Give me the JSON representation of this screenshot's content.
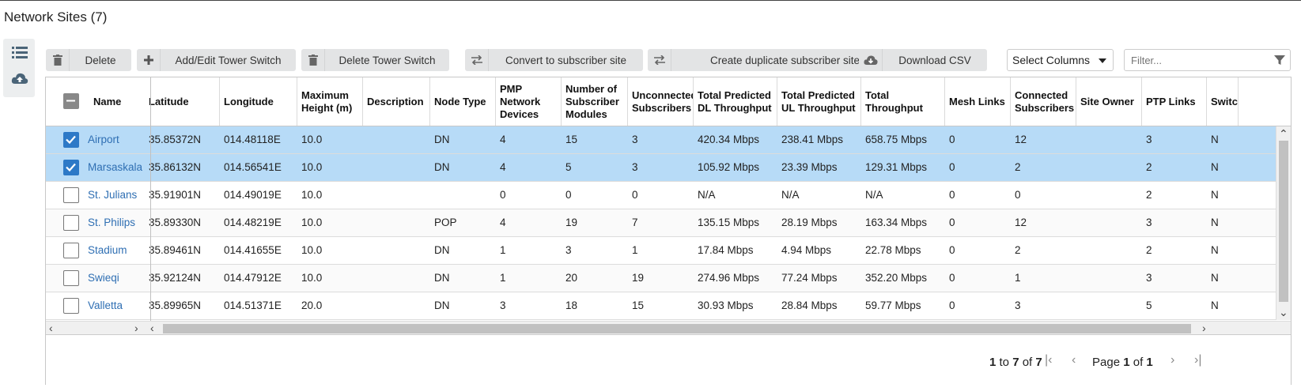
{
  "page": {
    "title": "Network Sites (7)"
  },
  "side_tools": [
    {
      "name": "list-view-icon"
    },
    {
      "name": "cloud-upload-icon"
    }
  ],
  "toolbar": {
    "buttons": [
      {
        "id": "delete",
        "label": "Delete",
        "icon": "trash-icon"
      },
      {
        "id": "add-edit-tower-switch",
        "label": "Add/Edit Tower Switch",
        "icon": "plus-icon"
      },
      {
        "id": "delete-tower-switch",
        "label": "Delete Tower Switch",
        "icon": "trash-icon"
      },
      {
        "id": "convert-to-subscriber",
        "label": "Convert to subscriber site",
        "icon": "swap-icon"
      },
      {
        "id": "create-duplicate-subscriber",
        "label": "Create duplicate subscriber site",
        "icon": "swap-icon"
      },
      {
        "id": "download-csv",
        "label": "Download CSV",
        "icon": "cloud-download-icon"
      }
    ],
    "select_columns": "Select Columns",
    "filter_placeholder": "Filter..."
  },
  "grid": {
    "columns": [
      "Name",
      "Latitude",
      "Longitude",
      "Maximum Height (m)",
      "Description",
      "Node Type",
      "PMP Network Devices",
      "Number of Subscriber Modules",
      "Unconnected Subscribers",
      "Total Predicted DL Throughput",
      "Total Predicted UL Throughput",
      "Total Throughput",
      "Mesh Links",
      "Connected Subscribers",
      "Site Owner",
      "PTP Links",
      "Switch"
    ],
    "rows": [
      {
        "selected": true,
        "cells": [
          "Airport",
          "35.85372N",
          "014.48118E",
          "10.0",
          "",
          "DN",
          "4",
          "15",
          "3",
          "420.34 Mbps",
          "238.41 Mbps",
          "658.75 Mbps",
          "0",
          "12",
          "",
          "3",
          "N"
        ]
      },
      {
        "selected": true,
        "cells": [
          "Marsaskala",
          "35.86132N",
          "014.56541E",
          "10.0",
          "",
          "DN",
          "4",
          "5",
          "3",
          "105.92 Mbps",
          "23.39 Mbps",
          "129.31 Mbps",
          "0",
          "2",
          "",
          "2",
          "N"
        ]
      },
      {
        "selected": false,
        "cells": [
          "St. Julians",
          "35.91901N",
          "014.49019E",
          "10.0",
          "",
          "",
          "0",
          "0",
          "0",
          "N/A",
          "N/A",
          "N/A",
          "0",
          "0",
          "",
          "2",
          "N"
        ]
      },
      {
        "selected": false,
        "cells": [
          "St. Philips",
          "35.89330N",
          "014.48219E",
          "10.0",
          "",
          "POP",
          "4",
          "19",
          "7",
          "135.15 Mbps",
          "28.19 Mbps",
          "163.34 Mbps",
          "0",
          "12",
          "",
          "3",
          "N"
        ]
      },
      {
        "selected": false,
        "cells": [
          "Stadium",
          "35.89461N",
          "014.41655E",
          "10.0",
          "",
          "DN",
          "1",
          "3",
          "1",
          "17.84 Mbps",
          "4.94 Mbps",
          "22.78 Mbps",
          "0",
          "2",
          "",
          "2",
          "N"
        ]
      },
      {
        "selected": false,
        "cells": [
          "Swieqi",
          "35.92124N",
          "014.47912E",
          "10.0",
          "",
          "DN",
          "1",
          "20",
          "19",
          "274.96 Mbps",
          "77.24 Mbps",
          "352.20 Mbps",
          "0",
          "1",
          "",
          "3",
          "N"
        ]
      },
      {
        "selected": false,
        "cells": [
          "Valletta",
          "35.89965N",
          "014.51371E",
          "20.0",
          "",
          "DN",
          "3",
          "18",
          "15",
          "30.93 Mbps",
          "28.84 Mbps",
          "59.77 Mbps",
          "0",
          "3",
          "",
          "5",
          "N"
        ]
      }
    ]
  },
  "pager": {
    "from": "1",
    "to_word": "to",
    "to": "7",
    "of_word": "of",
    "total": "7",
    "page_word": "Page",
    "page": "1",
    "page_of_word": "of",
    "pages": "1"
  },
  "colors": {
    "link": "#2f6fb3",
    "selected_row": "#b7dbf7",
    "checkbox_on": "#2d79c7"
  }
}
